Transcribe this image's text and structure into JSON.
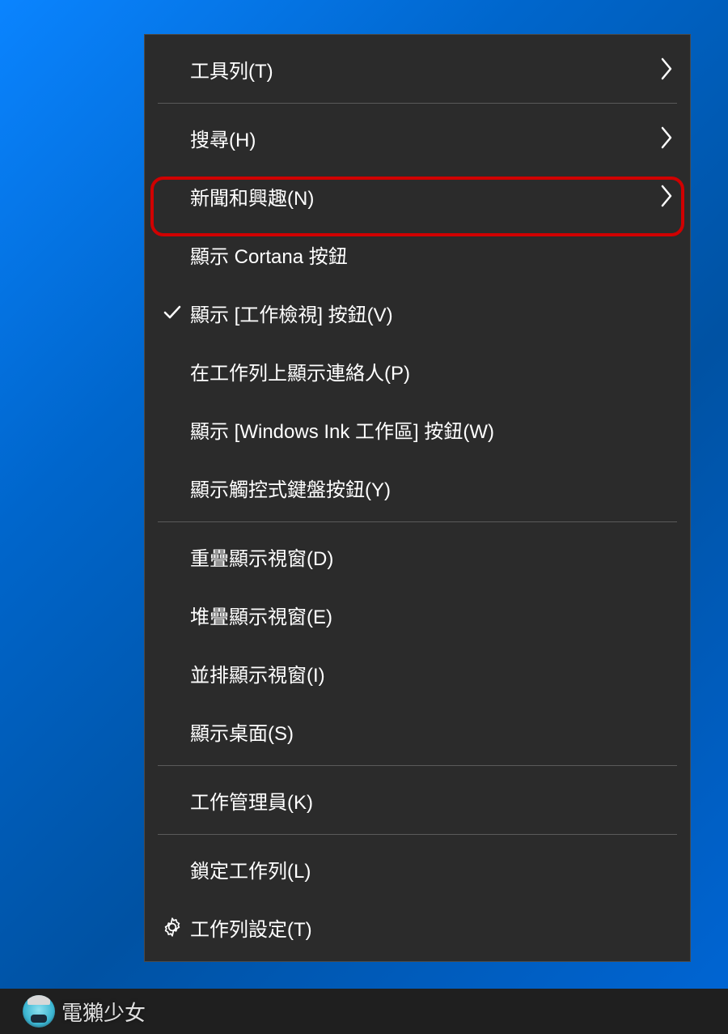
{
  "menu": {
    "items": [
      {
        "label": "工具列(T)",
        "hasSubmenu": true,
        "checked": false,
        "icon": null
      },
      {
        "separator": true
      },
      {
        "label": "搜尋(H)",
        "hasSubmenu": true,
        "checked": false,
        "icon": null
      },
      {
        "label": "新聞和興趣(N)",
        "hasSubmenu": true,
        "checked": false,
        "icon": null,
        "highlighted": true
      },
      {
        "label": "顯示 Cortana 按鈕",
        "hasSubmenu": false,
        "checked": false,
        "icon": null
      },
      {
        "label": "顯示 [工作檢視] 按鈕(V)",
        "hasSubmenu": false,
        "checked": true,
        "icon": null
      },
      {
        "label": "在工作列上顯示連絡人(P)",
        "hasSubmenu": false,
        "checked": false,
        "icon": null
      },
      {
        "label": "顯示 [Windows Ink 工作區] 按鈕(W)",
        "hasSubmenu": false,
        "checked": false,
        "icon": null
      },
      {
        "label": "顯示觸控式鍵盤按鈕(Y)",
        "hasSubmenu": false,
        "checked": false,
        "icon": null
      },
      {
        "separator": true
      },
      {
        "label": "重疊顯示視窗(D)",
        "hasSubmenu": false,
        "checked": false,
        "icon": null
      },
      {
        "label": "堆疊顯示視窗(E)",
        "hasSubmenu": false,
        "checked": false,
        "icon": null
      },
      {
        "label": "並排顯示視窗(I)",
        "hasSubmenu": false,
        "checked": false,
        "icon": null
      },
      {
        "label": "顯示桌面(S)",
        "hasSubmenu": false,
        "checked": false,
        "icon": null
      },
      {
        "separator": true
      },
      {
        "label": "工作管理員(K)",
        "hasSubmenu": false,
        "checked": false,
        "icon": null
      },
      {
        "separator": true
      },
      {
        "label": "鎖定工作列(L)",
        "hasSubmenu": false,
        "checked": false,
        "icon": null
      },
      {
        "label": "工作列設定(T)",
        "hasSubmenu": false,
        "checked": false,
        "icon": "gear"
      }
    ]
  },
  "watermark": {
    "text": "電獺少女"
  }
}
